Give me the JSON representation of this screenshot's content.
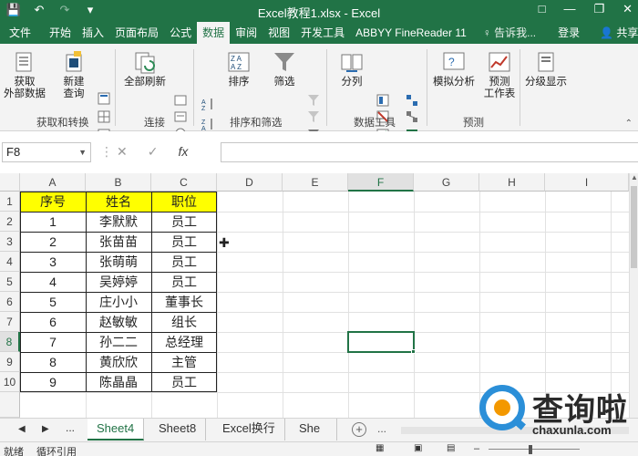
{
  "titlebar": {
    "title": "Excel教程1.xlsx - Excel",
    "qat": [
      "save-icon",
      "undo-icon",
      "redo-icon",
      "customize-icon"
    ],
    "window_controls": [
      "minimize-icon",
      "restore-icon",
      "close-icon"
    ],
    "accent": "#217346"
  },
  "tabs": [
    {
      "label": "文件"
    },
    {
      "label": "开始"
    },
    {
      "label": "插入"
    },
    {
      "label": "页面布局"
    },
    {
      "label": "公式"
    },
    {
      "label": "数据"
    },
    {
      "label": "审阅"
    },
    {
      "label": "视图"
    },
    {
      "label": "开发工具"
    },
    {
      "label": "ABBYY FineReader 11"
    }
  ],
  "tab_active": "数据",
  "tell_me": "♀ 告诉我...",
  "login": "登录",
  "share": "共享",
  "ribbon": {
    "get_data": "获取\n外部数据",
    "new_query": "新建\n查询",
    "refresh_all": "全部刷新",
    "sort": "排序",
    "filter": "筛选",
    "split": "分列",
    "what_if": "模拟分析",
    "forecast_sheet": "预测\n工作表",
    "outline": "分级显示",
    "groups": {
      "get_transform": "获取和转换",
      "connections": "连接",
      "sort_filter": "排序和筛选",
      "data_tools": "数据工具",
      "forecast": "预测"
    }
  },
  "formula_bar": {
    "name_box": "F8",
    "cancel": "✕",
    "enter": "✓",
    "fx": "fx",
    "value": ""
  },
  "grid": {
    "columns": [
      "A",
      "B",
      "C",
      "D",
      "E",
      "F",
      "G",
      "H",
      "I"
    ],
    "selected_column": "F",
    "rows": [
      "1",
      "2",
      "3",
      "4",
      "5",
      "6",
      "7",
      "8",
      "9",
      "10"
    ],
    "selected_row": "8",
    "header": [
      "序号",
      "姓名",
      "职位"
    ],
    "header_fill": "#ffff00",
    "data": [
      [
        "1",
        "李默默",
        "员工"
      ],
      [
        "2",
        "张苗苗",
        "员工"
      ],
      [
        "3",
        "张萌萌",
        "员工"
      ],
      [
        "4",
        "吴婷婷",
        "员工"
      ],
      [
        "5",
        "庄小小",
        "董事长"
      ],
      [
        "6",
        "赵敏敏",
        "组长"
      ],
      [
        "7",
        "孙二二",
        "总经理"
      ],
      [
        "8",
        "黄欣欣",
        "主管"
      ],
      [
        "9",
        "陈晶晶",
        "员工"
      ]
    ]
  },
  "sheets": {
    "tabs": [
      "Sheet4",
      "Sheet8",
      "Excel换行",
      "She"
    ],
    "active": "Sheet4",
    "ellipsis": "..."
  },
  "status": {
    "ready": "就绪",
    "circular": "循环引用"
  },
  "watermark": {
    "title": "查询啦",
    "url": "chaxunla.com"
  }
}
